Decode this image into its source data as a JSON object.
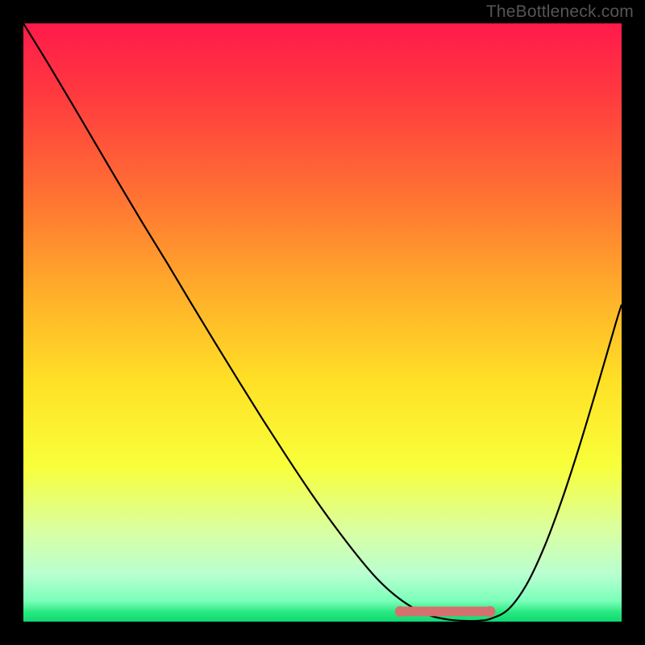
{
  "watermark": "TheBottleneck.com",
  "chart_data": {
    "type": "line",
    "title": "",
    "xlabel": "",
    "ylabel": "",
    "xlim": [
      0,
      100
    ],
    "ylim": [
      0,
      100
    ],
    "grid": false,
    "legend": false,
    "gradient_stops": [
      {
        "offset": 0.0,
        "color": "#ff1a4b"
      },
      {
        "offset": 0.12,
        "color": "#ff3a3f"
      },
      {
        "offset": 0.28,
        "color": "#ff6f33"
      },
      {
        "offset": 0.45,
        "color": "#ffae2a"
      },
      {
        "offset": 0.6,
        "color": "#ffe126"
      },
      {
        "offset": 0.74,
        "color": "#f8ff3a"
      },
      {
        "offset": 0.85,
        "color": "#d9ffa3"
      },
      {
        "offset": 0.92,
        "color": "#b9ffd0"
      },
      {
        "offset": 0.965,
        "color": "#7cffba"
      },
      {
        "offset": 0.985,
        "color": "#26e87e"
      },
      {
        "offset": 1.0,
        "color": "#10d873"
      }
    ],
    "series": [
      {
        "name": "bottleneck-curve",
        "color": "#000000",
        "width": 2.2,
        "x": [
          0,
          4,
          8,
          12,
          16,
          20,
          24,
          28,
          32,
          36,
          40,
          44,
          48,
          52,
          56,
          59,
          62,
          65,
          68,
          71,
          74,
          76,
          78,
          81,
          84,
          87,
          90,
          93,
          96,
          99,
          100
        ],
        "y": [
          100,
          93.5,
          86.8,
          80.0,
          73.2,
          66.5,
          60.0,
          53.3,
          46.7,
          40.2,
          33.8,
          27.6,
          21.6,
          16.0,
          10.8,
          7.3,
          4.5,
          2.4,
          1.0,
          0.35,
          0.12,
          0.14,
          0.45,
          2.0,
          6.0,
          12.3,
          20.3,
          29.5,
          39.5,
          49.8,
          53.0
        ]
      }
    ],
    "markers": {
      "name": "optimal-zone",
      "color": "#d4716f",
      "cap_radius": 6.5,
      "thickness": 12,
      "x_start": 63,
      "x_end": 78,
      "y": 1.7
    }
  }
}
